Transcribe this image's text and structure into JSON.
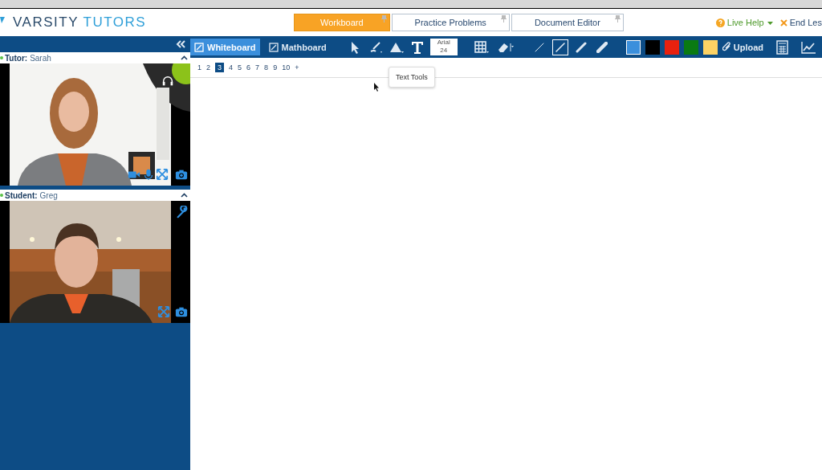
{
  "header": {
    "logo": {
      "first": "VARSITY",
      "second": "TUTORS"
    },
    "tabs": [
      {
        "label": "Workboard",
        "selected": true
      },
      {
        "label": "Practice Problems",
        "selected": false
      },
      {
        "label": "Document Editor",
        "selected": false
      }
    ],
    "live_help": "Live Help",
    "end_lesson": "End Les"
  },
  "sidebar": {
    "panels": [
      {
        "kind": "tutor",
        "role": "Tutor:",
        "name": "Sarah"
      },
      {
        "kind": "student",
        "role": "Student:",
        "name": "Greg"
      }
    ]
  },
  "toolbar": {
    "modes": [
      {
        "label": "Whiteboard",
        "selected": true
      },
      {
        "label": "Mathboard",
        "selected": false
      }
    ],
    "font": {
      "family": "Arial",
      "size": "24"
    },
    "line_widths": [
      {
        "selected": false
      },
      {
        "selected": true
      },
      {
        "selected": false
      },
      {
        "selected": false
      }
    ],
    "colors": [
      {
        "color": "#3b8fdc",
        "selected": true
      },
      {
        "color": "#000000",
        "selected": false
      },
      {
        "color": "#e8210f",
        "selected": false
      },
      {
        "color": "#0a7a12",
        "selected": false
      },
      {
        "color": "#fcd264",
        "selected": false
      }
    ],
    "upload": "Upload"
  },
  "tooltip": "Text Tools",
  "pages": {
    "items": [
      {
        "label": "1",
        "selected": false
      },
      {
        "label": "2",
        "selected": false
      },
      {
        "label": "3",
        "selected": true
      },
      {
        "label": "4",
        "selected": false
      },
      {
        "label": "5",
        "selected": false
      },
      {
        "label": "6",
        "selected": false
      },
      {
        "label": "7",
        "selected": false
      },
      {
        "label": "8",
        "selected": false
      },
      {
        "label": "9",
        "selected": false
      },
      {
        "label": "10",
        "selected": false
      }
    ],
    "add": "+"
  }
}
